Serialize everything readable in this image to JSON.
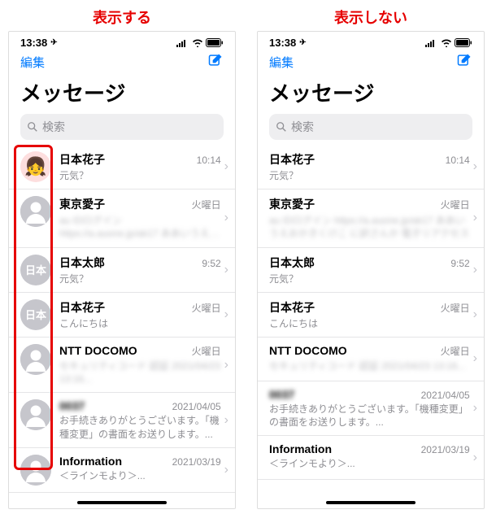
{
  "labels": {
    "show": "表示する",
    "hide": "表示しない"
  },
  "status": {
    "time": "13:38"
  },
  "nav": {
    "edit": "編集"
  },
  "title": "メッセージ",
  "search": {
    "placeholder": "検索"
  },
  "conversations": [
    {
      "name": "日本花子",
      "time": "10:14",
      "preview": "元気？",
      "avatar_kind": "emoji",
      "avatar_text": "👧"
    },
    {
      "name": "東京愛子",
      "time": "火曜日",
      "preview": "au IDログイン https://a.auone.jp/ak17 ああいうえおかきくけこ に訳さんか 電子リアクセス",
      "avatar_kind": "generic",
      "blur_preview": true
    },
    {
      "name": "日本太郎",
      "time": "9:52",
      "preview": "元気？",
      "avatar_kind": "text",
      "avatar_text": "日本"
    },
    {
      "name": "日本花子",
      "time": "火曜日",
      "preview": "こんにちは",
      "avatar_kind": "text",
      "avatar_text": "日本"
    },
    {
      "name": "NTT DOCOMO",
      "time": "火曜日",
      "preview": "セキュリティコード 認証 2021/04/23 13:16...",
      "avatar_kind": "generic",
      "blur_preview": true
    },
    {
      "name": "0037",
      "time": "2021/04/05",
      "preview": "お手続きありがとうございます。「機種変更」の書面をお送りします。...",
      "avatar_kind": "generic",
      "blur_name": true
    },
    {
      "name": "Information",
      "time": "2021/03/19",
      "preview": "＜ラインモより＞...",
      "avatar_kind": "generic"
    }
  ]
}
